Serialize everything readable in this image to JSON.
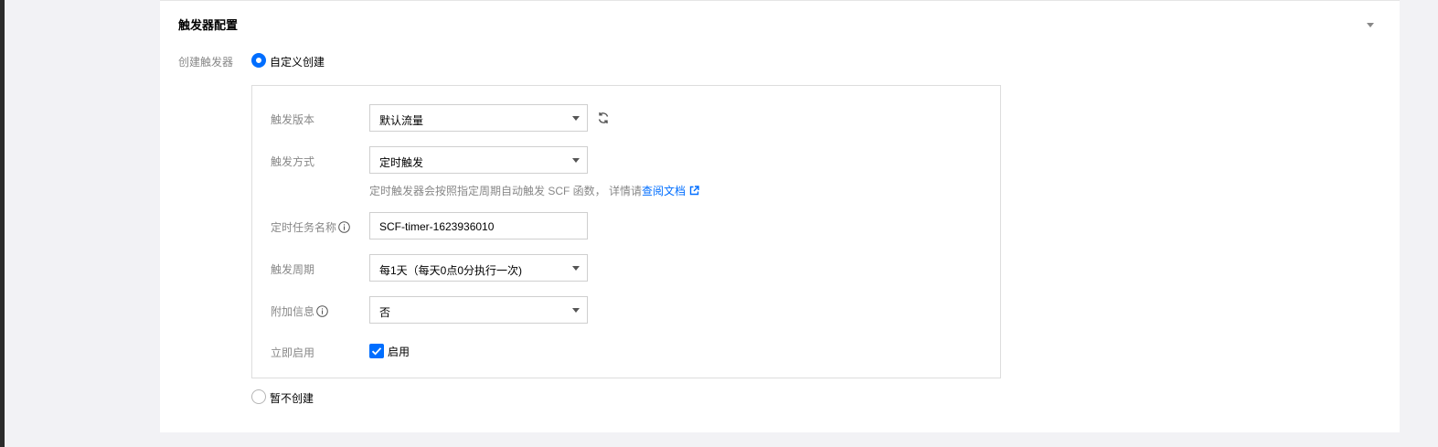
{
  "section": {
    "title": "触发器配置"
  },
  "create_trigger": {
    "label": "创建触发器",
    "option_custom": "自定义创建",
    "option_none": "暂不创建"
  },
  "form": {
    "version": {
      "label": "触发版本",
      "value": "默认流量"
    },
    "method": {
      "label": "触发方式",
      "value": "定时触发"
    },
    "help": {
      "text": "定时触发器会按照指定周期自动触发 SCF 函数， 详情请",
      "link": "查阅文档"
    },
    "task_name": {
      "label": "定时任务名称",
      "value": "SCF-timer-1623936010"
    },
    "period": {
      "label": "触发周期",
      "value": "每1天（每天0点0分执行一次)"
    },
    "extra": {
      "label": "附加信息",
      "value": "否"
    },
    "enable": {
      "label": "立即启用",
      "checkbox_label": "启用",
      "checked": true
    }
  },
  "icons": {
    "collapse": "triangle-down-icon",
    "refresh": "refresh-icon",
    "info": "info-circle-icon",
    "external": "external-link-icon",
    "check": "check-icon"
  },
  "colors": {
    "accent": "#006eff",
    "label_gray": "#888888",
    "border": "#dddddd",
    "background": "#f2f2f5"
  }
}
